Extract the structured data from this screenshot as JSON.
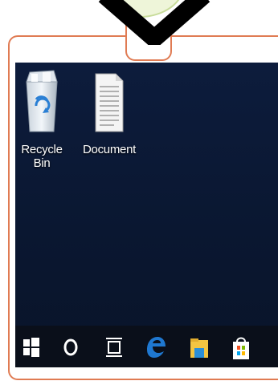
{
  "desktop": {
    "icons": [
      {
        "label": "Recycle Bin",
        "icon": "recycle-bin-icon"
      },
      {
        "label": "Document",
        "icon": "document-icon"
      }
    ]
  },
  "taskbar": {
    "items": [
      {
        "name": "start-button",
        "icon": "windows-logo-icon"
      },
      {
        "name": "search-button",
        "icon": "search-circle-icon"
      },
      {
        "name": "task-view-button",
        "icon": "task-view-icon"
      },
      {
        "name": "edge-button",
        "icon": "edge-icon"
      },
      {
        "name": "file-explorer-button",
        "icon": "folder-icon"
      },
      {
        "name": "store-button",
        "icon": "store-bag-icon"
      }
    ]
  },
  "colors": {
    "frame": "#e07b53",
    "desktop_bg": "#0d1c3c",
    "taskbar_bg": "#0a0f1a",
    "edge_blue": "#1f78d1",
    "folder_yellow": "#f3c542"
  }
}
